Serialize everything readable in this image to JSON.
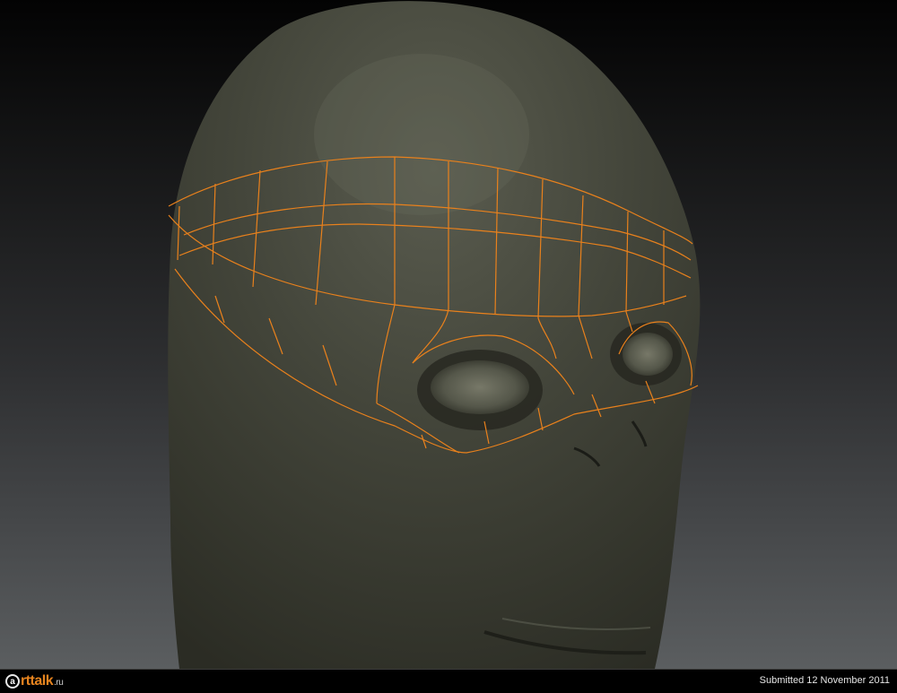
{
  "footer": {
    "logo": {
      "mark": "a",
      "brand": "rttalk",
      "domain": ".ru"
    },
    "caption": "Submitted 12 November 2011"
  },
  "render": {
    "background_top": "#020202",
    "background_bottom": "#5a5d5f",
    "skin_color": "#3e4035",
    "wire_color": "#e9811c",
    "subject": "sculpted creature head with orange topology band around the eyes"
  }
}
